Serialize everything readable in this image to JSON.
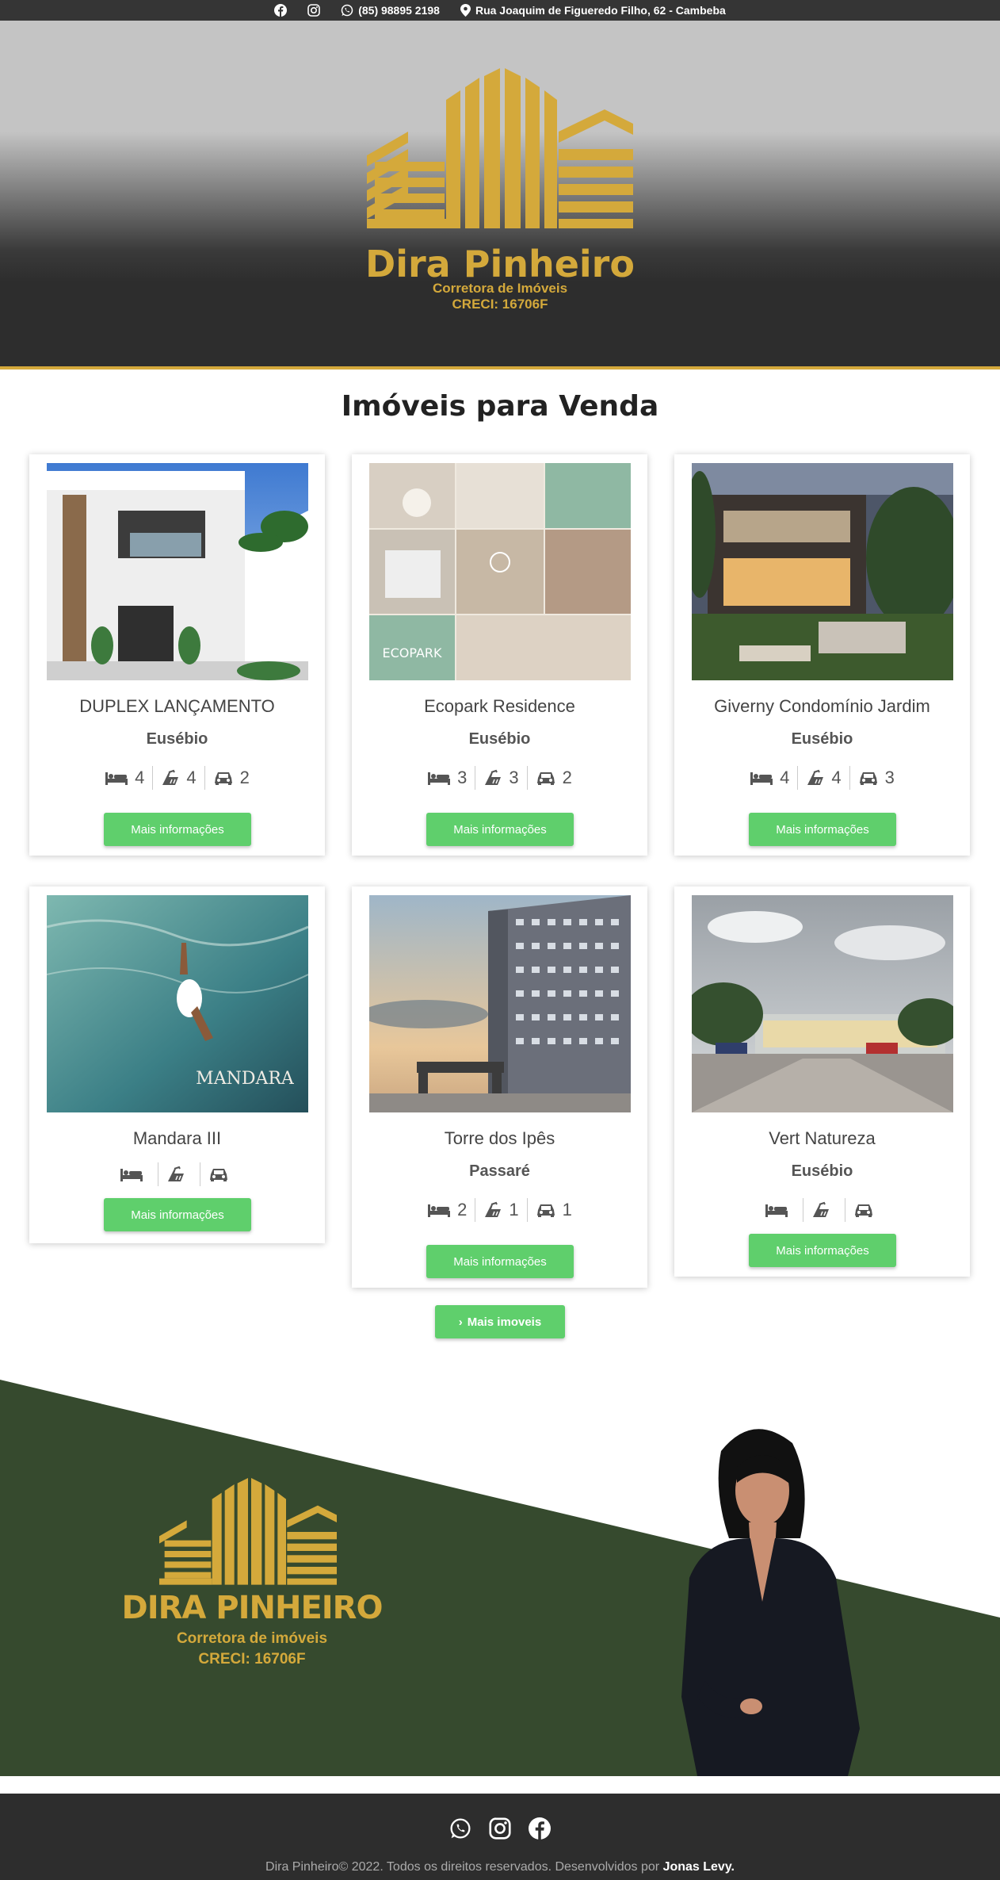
{
  "topbar": {
    "phone": "(85) 98895 2198",
    "address": "Rua Joaquim de Figueredo Filho, 62 - Cambeba",
    "icons": [
      "facebook-icon",
      "instagram-icon",
      "whatsapp-icon",
      "map-pin-icon"
    ]
  },
  "brand": {
    "name": "Dira Pinheiro",
    "subtitle": "Corretora de Imóveis",
    "creci": "CRECI:  16706F"
  },
  "section_title": "Imóveis para Venda",
  "listings": [
    {
      "title": "DUPLEX LANÇAMENTO",
      "location": "Eusébio",
      "beds": "4",
      "baths": "4",
      "cars": "2",
      "button": "Mais informações"
    },
    {
      "title": "Ecopark Residence",
      "location": "Eusébio",
      "beds": "3",
      "baths": "3",
      "cars": "2",
      "button": "Mais informações"
    },
    {
      "title": "Giverny Condomínio Jardim",
      "location": "Eusébio",
      "beds": "4",
      "baths": "4",
      "cars": "3",
      "button": "Mais informações"
    },
    {
      "title": "Mandara III",
      "location": "",
      "beds": "",
      "baths": "",
      "cars": "",
      "button": "Mais informações"
    },
    {
      "title": "Torre dos Ipês",
      "location": "Passaré",
      "beds": "2",
      "baths": "1",
      "cars": "1",
      "button": "Mais informações"
    },
    {
      "title": "Vert Natureza",
      "location": "Eusébio",
      "beds": "",
      "baths": "",
      "cars": "",
      "button": "Mais informações"
    }
  ],
  "more_button": "Mais imoveis",
  "about": {
    "name": "DIRA PINHEIRO",
    "subtitle": "Corretora de imóveis",
    "creci": "CRECI: 16706F",
    "colors": {
      "green": "#364a2e",
      "gold": "#d4a93b"
    }
  },
  "footer": {
    "text": "Dira Pinheiro© 2022. Todos os direitos reservados. Desenvolvidos por",
    "author": "Jonas Levy.",
    "icons": [
      "whatsapp-icon",
      "instagram-icon",
      "facebook-icon"
    ]
  }
}
